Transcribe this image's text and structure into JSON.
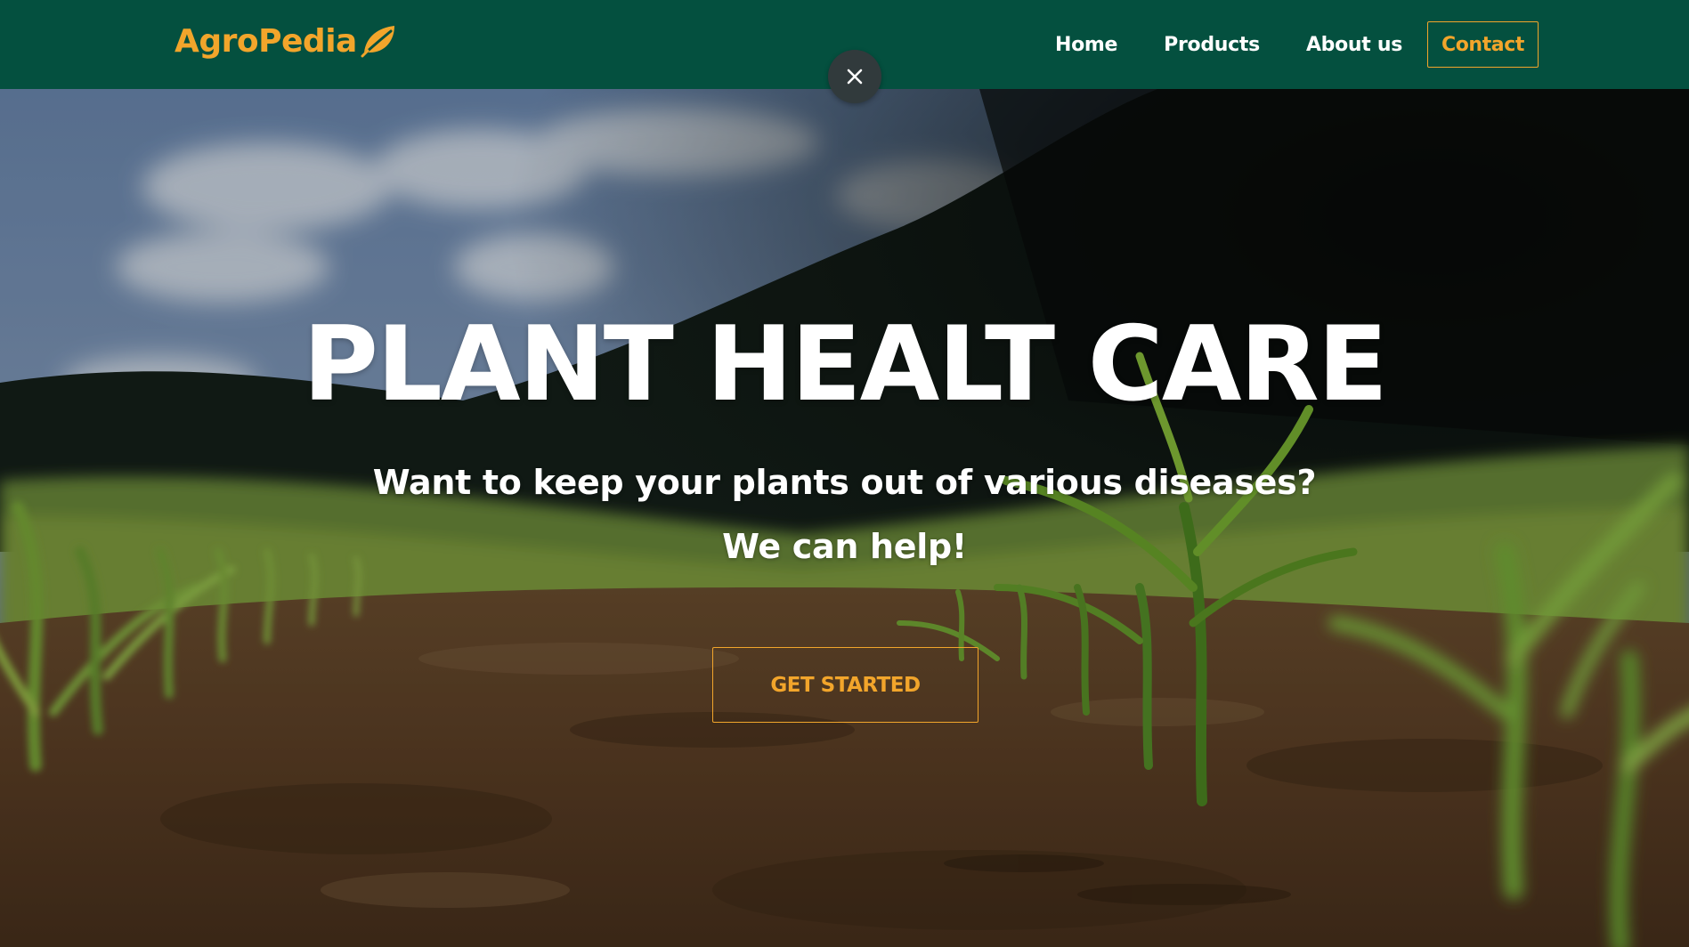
{
  "brand": {
    "name": "AgroPedia",
    "icon": "leaf-icon",
    "color": "#f2a52b"
  },
  "nav": {
    "background": "#04503f",
    "items": [
      {
        "label": "Home"
      },
      {
        "label": "Products"
      },
      {
        "label": "About us"
      }
    ],
    "contact_label": "Contact"
  },
  "overlay": {
    "close_icon": "close-icon"
  },
  "hero": {
    "title": "PLANT HEALT CARE",
    "subtitle": "Want to keep your plants out of various diseases?",
    "subtitle_2": "We can help!",
    "cta_label": "GET STARTED",
    "background_image": "corn-seedlings-field-photo"
  }
}
